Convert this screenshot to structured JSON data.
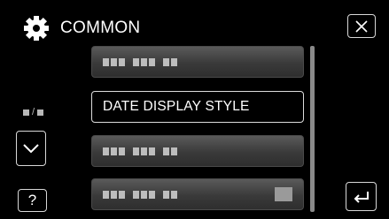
{
  "header": {
    "title": "COMMON",
    "icon": "gear-icon"
  },
  "menu": {
    "items": [
      {
        "label": "",
        "placeholder": true,
        "selected": false
      },
      {
        "label": "DATE DISPLAY STYLE",
        "placeholder": false,
        "selected": true
      },
      {
        "label": "",
        "placeholder": true,
        "selected": false
      },
      {
        "label": "",
        "placeholder": true,
        "selected": false,
        "trailing_icon": true
      }
    ]
  },
  "controls": {
    "help_label": "?",
    "close_icon": "close-icon",
    "down_icon": "chevron-down-icon",
    "back_icon": "return-icon"
  },
  "colors": {
    "background": "#000000",
    "item": "#3c3c3c",
    "outline": "#dcdcdc"
  }
}
